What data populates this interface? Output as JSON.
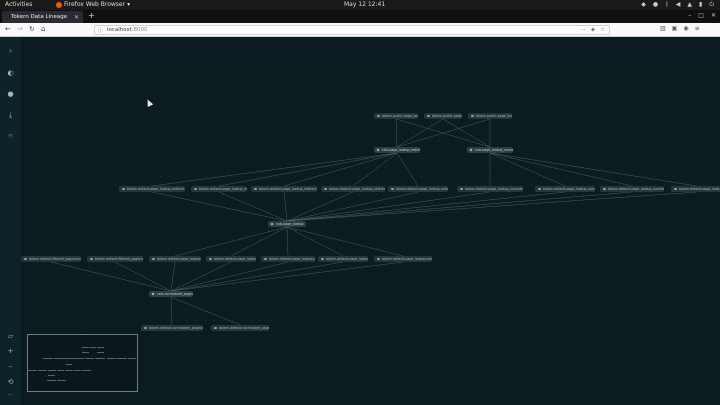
{
  "os_bar": {
    "activities": "Activities",
    "app_name": "Firefox Web Browser",
    "clock": "May 12  12:41"
  },
  "browser": {
    "tab_title": "Tokern Data Lineage",
    "url_host": "localhost",
    "url_port": ":8000"
  },
  "lineage": {
    "nodes": [
      {
        "id": "s1",
        "label": "tokern.public.page_lookup",
        "type": "table"
      },
      {
        "id": "s2",
        "label": "tokern.public.page_lookup_id",
        "type": "table"
      },
      {
        "id": "s3",
        "label": "tokern.public.page_lookup_title",
        "type": "table"
      },
      {
        "id": "m1",
        "label": "calc.page_lookup_redirect",
        "type": "model"
      },
      {
        "id": "m2",
        "label": "calc.page_lookup_nonredirect",
        "type": "model"
      },
      {
        "id": "c1",
        "label": "tokern.default.page_lookup_redirect.page_version",
        "type": "column"
      },
      {
        "id": "c2",
        "label": "tokern.default.page_lookup_redirect.page_id",
        "type": "column"
      },
      {
        "id": "c3",
        "label": "tokern.default.page_lookup_redirect.redirect_id",
        "type": "column"
      },
      {
        "id": "c4",
        "label": "tokern.default.page_lookup_redirect.redirect_title",
        "type": "column"
      },
      {
        "id": "c5",
        "label": "tokern.default.page_lookup_redirect.true_title",
        "type": "column"
      },
      {
        "id": "c6",
        "label": "tokern.default.page_lookup_nonredirect.redirect_id",
        "type": "column"
      },
      {
        "id": "c7",
        "label": "tokern.default.page_lookup_nonredirect.page_id",
        "type": "column"
      },
      {
        "id": "c8",
        "label": "tokern.default.page_lookup_nonredirect.true_title",
        "type": "column"
      },
      {
        "id": "c9",
        "label": "tokern.default.page_lookup_nonredirect.title",
        "type": "column"
      },
      {
        "id": "m3",
        "label": "calc.page_lookup",
        "type": "model"
      },
      {
        "id": "d1",
        "label": "tokern.default.filtered_pagecounts.date",
        "type": "column"
      },
      {
        "id": "d2",
        "label": "tokern.default.filtered_pagecounts.views",
        "type": "column"
      },
      {
        "id": "d3",
        "label": "tokern.default.page_lookup.page_id",
        "type": "column"
      },
      {
        "id": "d4",
        "label": "tokern.default.page_lookup.true_title",
        "type": "column"
      },
      {
        "id": "d5",
        "label": "tokern.default.page_lookup.page_version",
        "type": "column"
      },
      {
        "id": "d6",
        "label": "tokern.default.page_lookup.redirect_id",
        "type": "column"
      },
      {
        "id": "d7",
        "label": "tokern.default.page_lookup.redirect_title",
        "type": "column"
      },
      {
        "id": "m4",
        "label": "calc.normalized_pagecounts",
        "type": "model"
      },
      {
        "id": "n1",
        "label": "tokern.default.normalized_pagecounts.page_url",
        "type": "column"
      },
      {
        "id": "n2",
        "label": "tokern.default.normalized_pagecounts.page_title",
        "type": "column"
      }
    ]
  }
}
